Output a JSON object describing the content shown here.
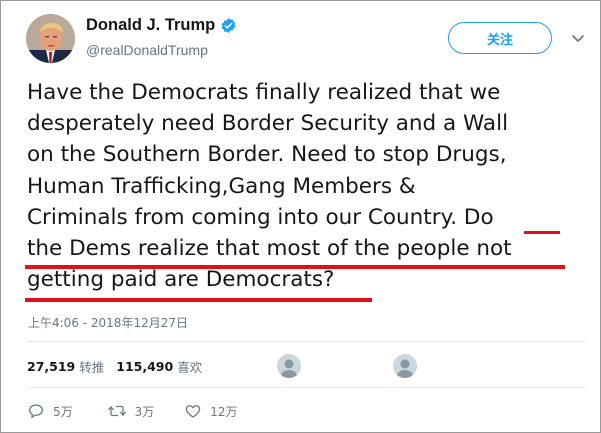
{
  "user": {
    "display_name": "Donald J. Trump",
    "handle": "@realDonaldTrump",
    "verified_icon": "verified-badge-icon"
  },
  "follow_button": {
    "label": "关注"
  },
  "tweet": {
    "lines": [
      "Have the Democrats finally realized that we",
      "desperately need Border Security and a Wall",
      "on the Southern Border. Need to stop Drugs,",
      "Human Trafficking,Gang Members &",
      "Criminals from coming into our Country. Do",
      "the Dems realize that most of the people not",
      "getting paid are Democrats?"
    ],
    "timestamp": "上午4:06 - 2018年12月27日"
  },
  "stats": {
    "retweets_count": "27,519",
    "retweets_label": "转推",
    "likes_count": "115,490",
    "likes_label": "喜欢"
  },
  "actions": {
    "reply_count": "5万",
    "retweet_count": "3万",
    "like_count": "12万"
  },
  "colors": {
    "accent": "#1da1f2",
    "annotation_red": "#e0101a",
    "muted_text": "#657786"
  }
}
